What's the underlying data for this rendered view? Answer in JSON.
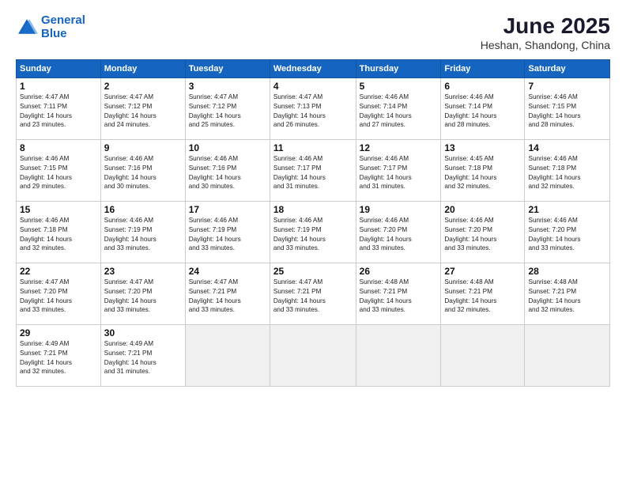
{
  "header": {
    "logo_line1": "General",
    "logo_line2": "Blue",
    "title": "June 2025",
    "subtitle": "Heshan, Shandong, China"
  },
  "weekdays": [
    "Sunday",
    "Monday",
    "Tuesday",
    "Wednesday",
    "Thursday",
    "Friday",
    "Saturday"
  ],
  "weeks": [
    [
      {
        "day": "1",
        "info": "Sunrise: 4:47 AM\nSunset: 7:11 PM\nDaylight: 14 hours\nand 23 minutes."
      },
      {
        "day": "2",
        "info": "Sunrise: 4:47 AM\nSunset: 7:12 PM\nDaylight: 14 hours\nand 24 minutes."
      },
      {
        "day": "3",
        "info": "Sunrise: 4:47 AM\nSunset: 7:12 PM\nDaylight: 14 hours\nand 25 minutes."
      },
      {
        "day": "4",
        "info": "Sunrise: 4:47 AM\nSunset: 7:13 PM\nDaylight: 14 hours\nand 26 minutes."
      },
      {
        "day": "5",
        "info": "Sunrise: 4:46 AM\nSunset: 7:14 PM\nDaylight: 14 hours\nand 27 minutes."
      },
      {
        "day": "6",
        "info": "Sunrise: 4:46 AM\nSunset: 7:14 PM\nDaylight: 14 hours\nand 28 minutes."
      },
      {
        "day": "7",
        "info": "Sunrise: 4:46 AM\nSunset: 7:15 PM\nDaylight: 14 hours\nand 28 minutes."
      }
    ],
    [
      {
        "day": "8",
        "info": "Sunrise: 4:46 AM\nSunset: 7:15 PM\nDaylight: 14 hours\nand 29 minutes."
      },
      {
        "day": "9",
        "info": "Sunrise: 4:46 AM\nSunset: 7:16 PM\nDaylight: 14 hours\nand 30 minutes."
      },
      {
        "day": "10",
        "info": "Sunrise: 4:46 AM\nSunset: 7:16 PM\nDaylight: 14 hours\nand 30 minutes."
      },
      {
        "day": "11",
        "info": "Sunrise: 4:46 AM\nSunset: 7:17 PM\nDaylight: 14 hours\nand 31 minutes."
      },
      {
        "day": "12",
        "info": "Sunrise: 4:46 AM\nSunset: 7:17 PM\nDaylight: 14 hours\nand 31 minutes."
      },
      {
        "day": "13",
        "info": "Sunrise: 4:45 AM\nSunset: 7:18 PM\nDaylight: 14 hours\nand 32 minutes."
      },
      {
        "day": "14",
        "info": "Sunrise: 4:46 AM\nSunset: 7:18 PM\nDaylight: 14 hours\nand 32 minutes."
      }
    ],
    [
      {
        "day": "15",
        "info": "Sunrise: 4:46 AM\nSunset: 7:18 PM\nDaylight: 14 hours\nand 32 minutes."
      },
      {
        "day": "16",
        "info": "Sunrise: 4:46 AM\nSunset: 7:19 PM\nDaylight: 14 hours\nand 33 minutes."
      },
      {
        "day": "17",
        "info": "Sunrise: 4:46 AM\nSunset: 7:19 PM\nDaylight: 14 hours\nand 33 minutes."
      },
      {
        "day": "18",
        "info": "Sunrise: 4:46 AM\nSunset: 7:19 PM\nDaylight: 14 hours\nand 33 minutes."
      },
      {
        "day": "19",
        "info": "Sunrise: 4:46 AM\nSunset: 7:20 PM\nDaylight: 14 hours\nand 33 minutes."
      },
      {
        "day": "20",
        "info": "Sunrise: 4:46 AM\nSunset: 7:20 PM\nDaylight: 14 hours\nand 33 minutes."
      },
      {
        "day": "21",
        "info": "Sunrise: 4:46 AM\nSunset: 7:20 PM\nDaylight: 14 hours\nand 33 minutes."
      }
    ],
    [
      {
        "day": "22",
        "info": "Sunrise: 4:47 AM\nSunset: 7:20 PM\nDaylight: 14 hours\nand 33 minutes."
      },
      {
        "day": "23",
        "info": "Sunrise: 4:47 AM\nSunset: 7:20 PM\nDaylight: 14 hours\nand 33 minutes."
      },
      {
        "day": "24",
        "info": "Sunrise: 4:47 AM\nSunset: 7:21 PM\nDaylight: 14 hours\nand 33 minutes."
      },
      {
        "day": "25",
        "info": "Sunrise: 4:47 AM\nSunset: 7:21 PM\nDaylight: 14 hours\nand 33 minutes."
      },
      {
        "day": "26",
        "info": "Sunrise: 4:48 AM\nSunset: 7:21 PM\nDaylight: 14 hours\nand 33 minutes."
      },
      {
        "day": "27",
        "info": "Sunrise: 4:48 AM\nSunset: 7:21 PM\nDaylight: 14 hours\nand 32 minutes."
      },
      {
        "day": "28",
        "info": "Sunrise: 4:48 AM\nSunset: 7:21 PM\nDaylight: 14 hours\nand 32 minutes."
      }
    ],
    [
      {
        "day": "29",
        "info": "Sunrise: 4:49 AM\nSunset: 7:21 PM\nDaylight: 14 hours\nand 32 minutes."
      },
      {
        "day": "30",
        "info": "Sunrise: 4:49 AM\nSunset: 7:21 PM\nDaylight: 14 hours\nand 31 minutes."
      },
      {
        "day": "",
        "info": ""
      },
      {
        "day": "",
        "info": ""
      },
      {
        "day": "",
        "info": ""
      },
      {
        "day": "",
        "info": ""
      },
      {
        "day": "",
        "info": ""
      }
    ]
  ]
}
